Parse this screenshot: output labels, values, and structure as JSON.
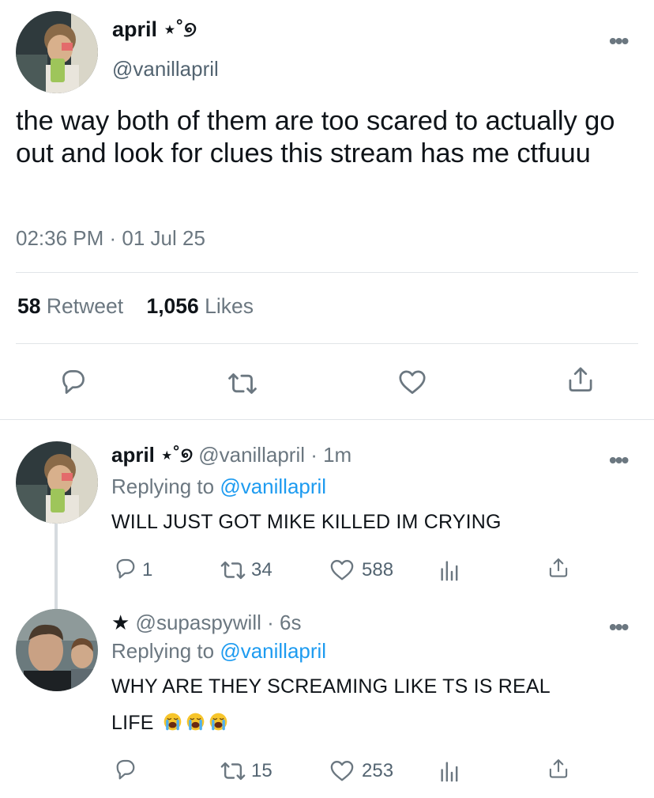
{
  "main_tweet": {
    "name": "april ⋆˚୭",
    "handle": "@vanillapril",
    "text": "the way both of them are too scared to actually go out and look for clues this stream has me ctfuuu",
    "timestamp": "02:36 PM · 01 Jul 25",
    "retweet_count": "58",
    "retweet_label": "Retweet",
    "likes_count": "1,056",
    "likes_label": "Likes",
    "icons": [
      "reply-icon",
      "retweet-icon",
      "heart-icon",
      "share-icon"
    ]
  },
  "replies": [
    {
      "name": "april ⋆˚୭",
      "handle_time": "@vanillapril · 1m",
      "replying_prefix": "Replying to",
      "replying_to": "@vanillapril",
      "text": "WILL JUST GOT MIKE KILLED IM CRYING",
      "reply_count": "1",
      "retweet_count": "34",
      "like_count": "588"
    },
    {
      "name": "★",
      "handle_time": "@supaspywill · 6s",
      "replying_prefix": "Replying to",
      "replying_to": "@vanillapril",
      "text_line1": "WHY ARE THEY SCREAMING LIKE TS IS REAL",
      "text_line2": "LIFE",
      "emoji": "😭😭😭",
      "reply_count": "",
      "retweet_count": "15",
      "like_count": "253"
    }
  ],
  "more_label": "•••",
  "colors": {
    "text": "#0f1419",
    "muted": "#6b7780",
    "link": "#1d9bf0",
    "divider": "#e1e5e8"
  }
}
